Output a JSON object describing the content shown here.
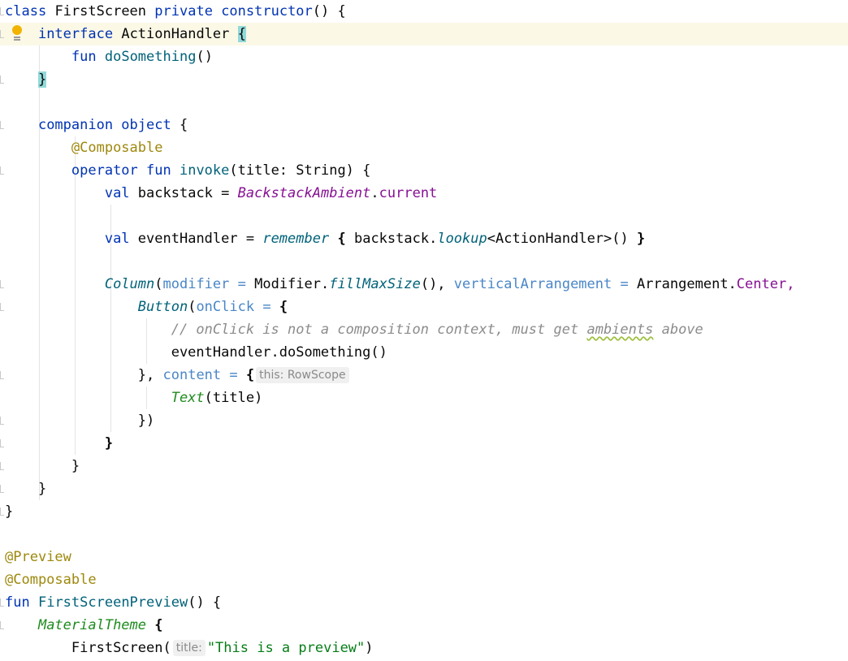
{
  "editor": {
    "lines": {
      "l1": {
        "kw1": "class",
        "name": "FirstScreen",
        "kw2": "private",
        "kw3": "constructor",
        "rest": "() {"
      },
      "l2": {
        "kw": "interface",
        "name": "ActionHandler",
        "brace": "{"
      },
      "l3": {
        "kw": "fun",
        "name": "doSomething",
        "rest": "()"
      },
      "l4": {
        "brace": "}"
      },
      "l6": {
        "kw": "companion object",
        "rest": "{"
      },
      "l7": {
        "ann": "@Composable"
      },
      "l8": {
        "kw": "operator fun",
        "name": "invoke",
        "rest": "(title: String) {"
      },
      "l9": {
        "kw": "val",
        "a": "backstack = ",
        "obj": "BackstackAmbient",
        "dot": ".",
        "prop": "current"
      },
      "l11": {
        "kw": "val",
        "a": "eventHandler = ",
        "fn": "remember",
        "b": "{",
        "c": "backstack.",
        "fn2": "lookup",
        "d": "<ActionHandler>()",
        "e": "}"
      },
      "l13": {
        "fn": "Column",
        "p1": "(",
        "named1": "modifier =",
        "a": "Modifier.",
        "fn2": "fillMaxSize",
        "b": "(), ",
        "named2": "verticalArrangement =",
        "c": "Arrangement.",
        "prop": "Center,"
      },
      "l14": {
        "fn": "Button",
        "p1": "(",
        "named": "onClick =",
        "brace": "{"
      },
      "l15": {
        "comment_a": "// onClick is not a composition context, must get",
        "comment_w": "ambients",
        "comment_b": "above"
      },
      "l16": {
        "text": "eventHandler.doSomething()"
      },
      "l17": {
        "a": "},",
        "named": "content =",
        "brace": "{",
        "hint": "this: RowScope"
      },
      "l18": {
        "fn": "Text",
        "rest": "(title)"
      },
      "l19": {
        "text": "})"
      },
      "l20": {
        "text": "}"
      },
      "l21": {
        "text": "}"
      },
      "l22": {
        "text": "}"
      },
      "l23": {
        "text": "}"
      },
      "l25": {
        "ann": "@Preview"
      },
      "l26": {
        "ann": "@Composable"
      },
      "l27": {
        "kw": "fun",
        "name": "FirstScreenPreview",
        "rest": "() {"
      },
      "l28": {
        "fn": "MaterialTheme",
        "rest": "{"
      },
      "l29": {
        "a": "FirstScreen(",
        "hint": "title:",
        "str": "\"This is a preview\"",
        "b": ")"
      }
    }
  },
  "colors": {
    "keyword": "#0033b3",
    "annotation": "#9e880d",
    "function_decl": "#00627a",
    "property": "#871094",
    "named_arg": "#4a86c8",
    "string": "#067d17",
    "composable": "#1e8b1e",
    "comment": "#8c8c8c",
    "highlight_line": "#fbf8e6",
    "brace_match": "#93d9d9",
    "intention_bulb": "#f2b300"
  },
  "icons": [
    "intention-bulb-icon",
    "fold-marker-icon"
  ]
}
